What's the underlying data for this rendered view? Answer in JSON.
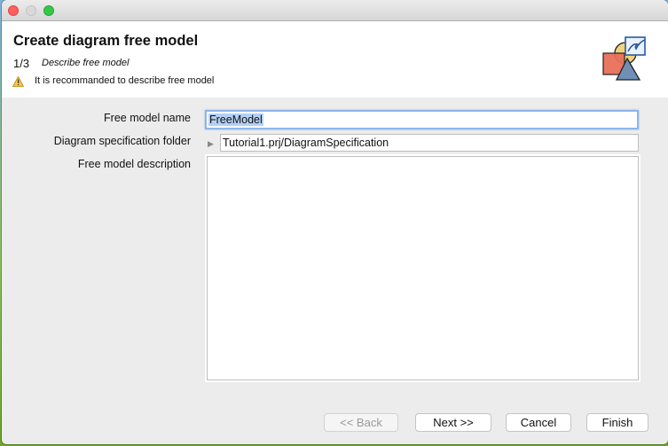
{
  "window": {
    "controls": [
      "close",
      "minimize",
      "maximize"
    ]
  },
  "header": {
    "title": "Create diagram free model",
    "step": "1/3",
    "step_description": "Describe free model",
    "warning_icon": "warning-triangle-icon",
    "warning_text": "It is recommanded to describe free model",
    "logo_icon": "diagram-shapes-icon"
  },
  "form": {
    "free_model_name": {
      "label": "Free model name",
      "value": "FreeModel"
    },
    "diagram_spec_folder": {
      "label": "Diagram specification folder",
      "value": "Tutorial1.prj/DiagramSpecification",
      "expand_icon": "triangle-right-icon"
    },
    "free_model_description": {
      "label": "Free model description",
      "value": ""
    }
  },
  "buttons": {
    "back": "<< Back",
    "next": "Next >>",
    "cancel": "Cancel",
    "finish": "Finish"
  }
}
